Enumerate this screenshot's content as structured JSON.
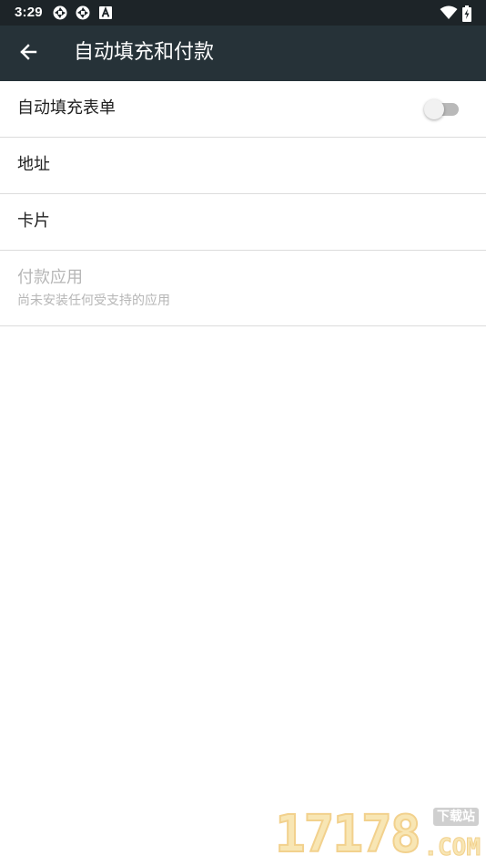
{
  "status_bar": {
    "time": "3:29",
    "icons": [
      "aperture-icon",
      "aperture-icon",
      "font-a-icon",
      "wifi-icon",
      "battery-charging-icon"
    ]
  },
  "app_bar": {
    "title": "自动填充和付款",
    "back_icon": "arrow-left-icon"
  },
  "settings": {
    "autofill_forms": {
      "label": "自动填充表单",
      "enabled": false
    },
    "addresses": {
      "label": "地址"
    },
    "cards": {
      "label": "卡片"
    },
    "payment_apps": {
      "label": "付款应用",
      "summary": "尚未安装任何受支持的应用",
      "disabled": true
    }
  },
  "watermark": {
    "digits": "17178",
    "badge": "下载站",
    "suffix": ".COM"
  },
  "colors": {
    "status_bar": "#1d2428",
    "app_bar": "#263238",
    "divider": "#dcdcdc",
    "disabled_text": "#b6b6b6"
  }
}
